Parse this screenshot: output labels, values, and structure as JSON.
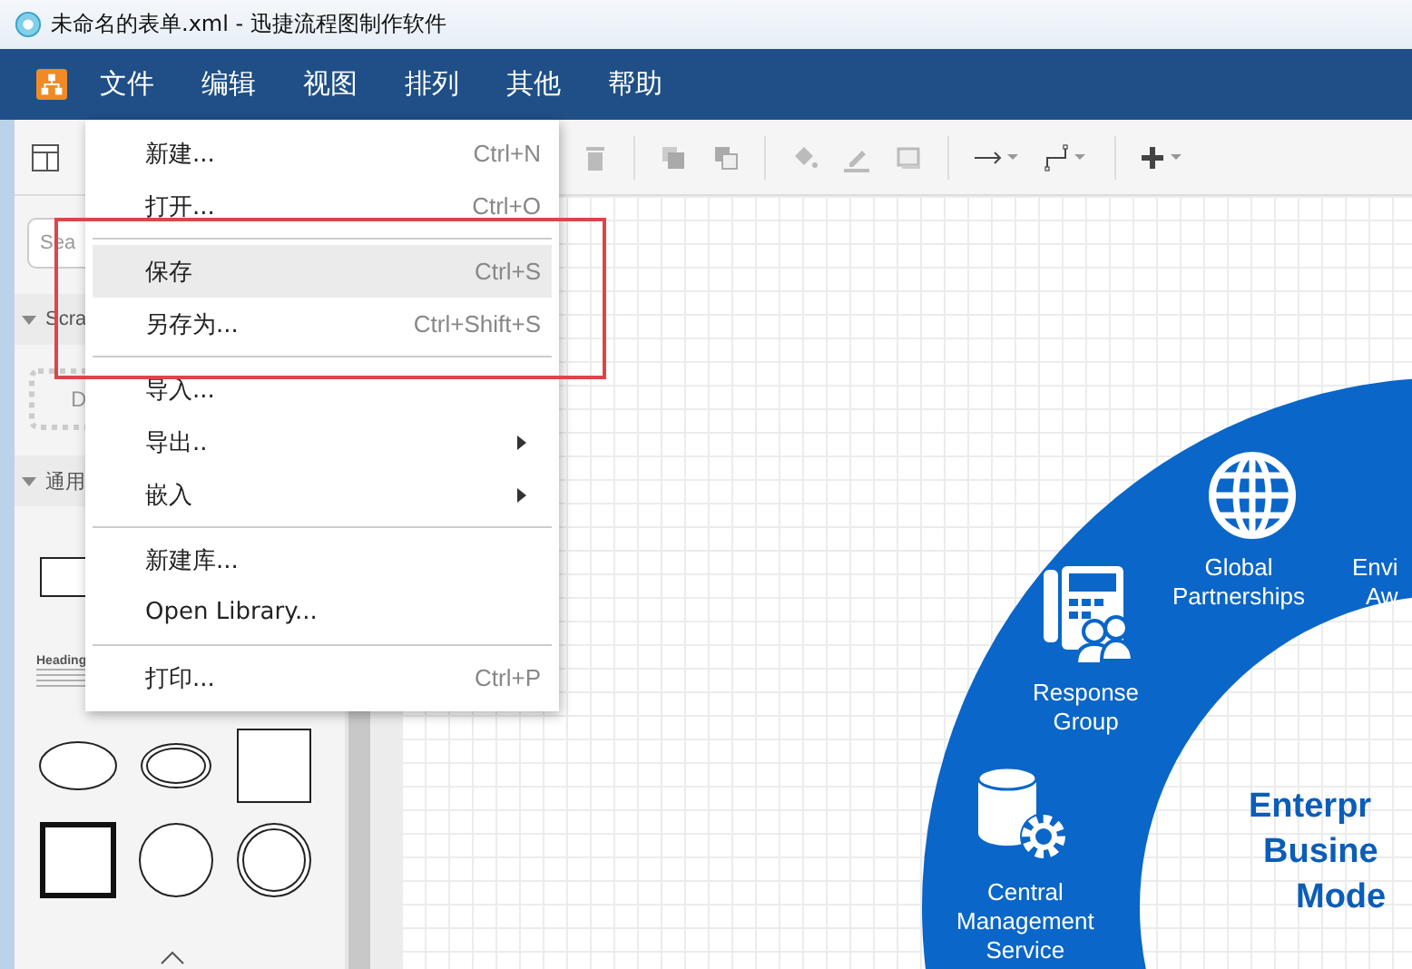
{
  "window": {
    "title": "未命名的表单.xml - 迅捷流程图制作软件"
  },
  "menubar": {
    "items": [
      {
        "label": "文件"
      },
      {
        "label": "编辑"
      },
      {
        "label": "视图"
      },
      {
        "label": "排列"
      },
      {
        "label": "其他"
      },
      {
        "label": "帮助"
      }
    ]
  },
  "file_menu": {
    "items": [
      {
        "kind": "item",
        "label": "新建...",
        "shortcut": "Ctrl+N",
        "selected": false,
        "submenu": false
      },
      {
        "kind": "item",
        "label": "打开...",
        "shortcut": "Ctrl+O",
        "selected": false,
        "submenu": false
      },
      {
        "kind": "separator"
      },
      {
        "kind": "item",
        "label": "保存",
        "shortcut": "Ctrl+S",
        "selected": true,
        "submenu": false
      },
      {
        "kind": "item",
        "label": "另存为...",
        "shortcut": "Ctrl+Shift+S",
        "selected": false,
        "submenu": false
      },
      {
        "kind": "separator"
      },
      {
        "kind": "item",
        "label": "导入...",
        "selected": false,
        "submenu": false
      },
      {
        "kind": "item",
        "label": "导出..",
        "selected": false,
        "submenu": true
      },
      {
        "kind": "item",
        "label": "嵌入",
        "selected": false,
        "submenu": true
      },
      {
        "kind": "separator"
      },
      {
        "kind": "item",
        "label": "新建库...",
        "selected": false,
        "submenu": false
      },
      {
        "kind": "item",
        "label": "Open Library...",
        "selected": false,
        "submenu": false
      },
      {
        "kind": "separator"
      },
      {
        "kind": "item",
        "label": "打印...",
        "shortcut": "Ctrl+P",
        "selected": false,
        "submenu": false
      }
    ]
  },
  "sidebar": {
    "search": {
      "placeholder": "Sea"
    },
    "sections": [
      {
        "title": "Scra",
        "expanded": true
      },
      {
        "title": "通用",
        "expanded": true
      }
    ],
    "scratchpad_hint": "D",
    "shape_heading": "Heading"
  },
  "diagram": {
    "ring_labels": [
      {
        "kind": "globe",
        "lines": [
          "Global",
          "Partnerships"
        ]
      },
      {
        "kind": "partial",
        "lines": [
          "Envi",
          "Aw"
        ]
      },
      {
        "kind": "phone",
        "lines": [
          "Response",
          "Group"
        ]
      },
      {
        "kind": "database",
        "lines": [
          "Central",
          "Management",
          "Service"
        ]
      }
    ],
    "center_title": [
      "Enterpr",
      "Busine",
      "Mode"
    ]
  }
}
